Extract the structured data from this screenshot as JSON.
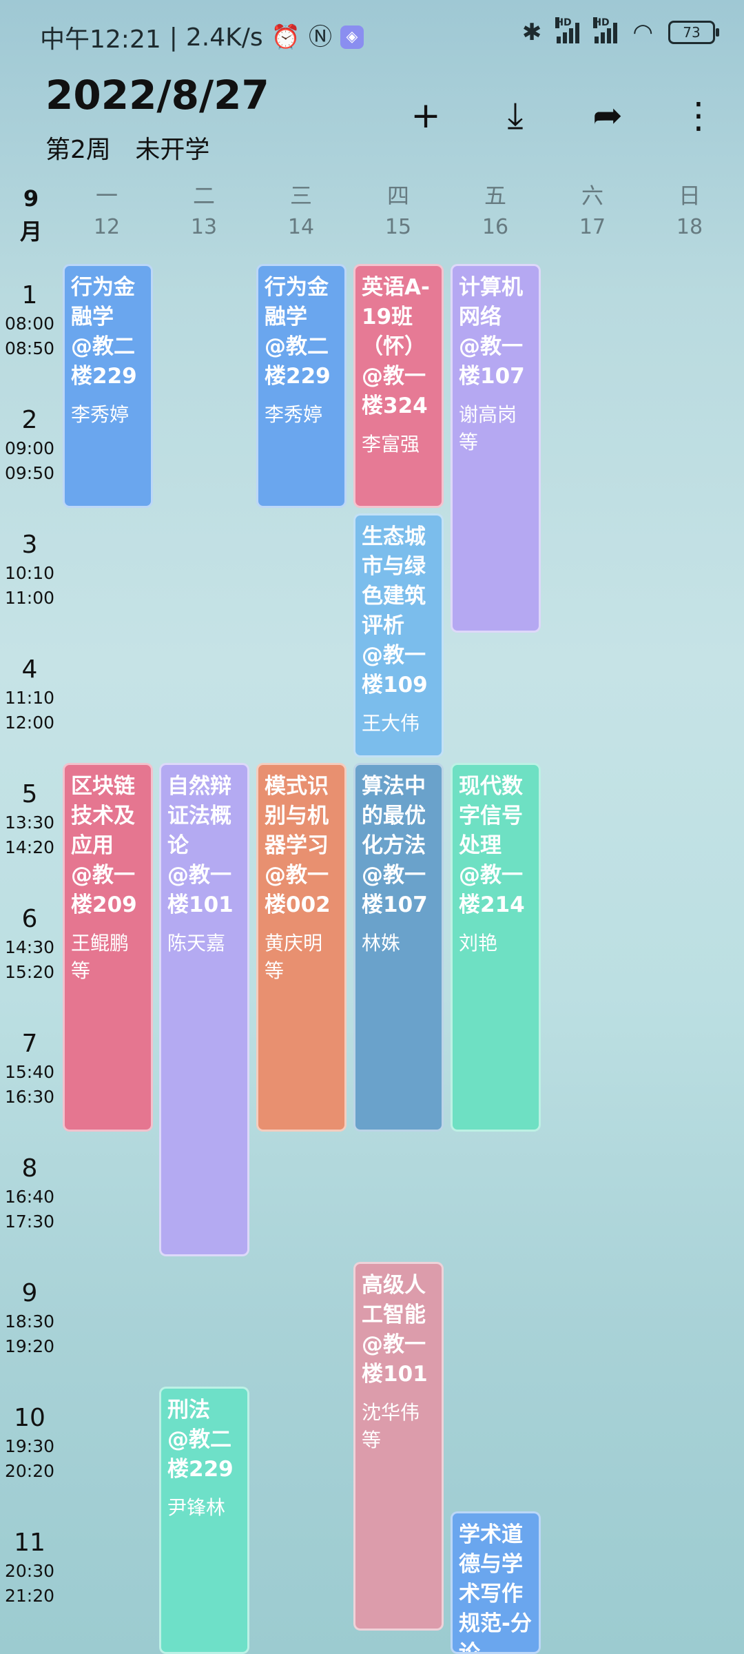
{
  "status_bar": {
    "time": "中午12:21",
    "speed": "2.4K/s",
    "battery": "73"
  },
  "header": {
    "date": "2022/8/27",
    "week": "第2周",
    "status": "未开学"
  },
  "toolbar": {
    "add": "+",
    "download": "⤓",
    "share": "➦",
    "more": "⋮"
  },
  "month": {
    "num": "9",
    "unit": "月"
  },
  "days": [
    {
      "wd": "一",
      "dn": "12"
    },
    {
      "wd": "二",
      "dn": "13"
    },
    {
      "wd": "三",
      "dn": "14"
    },
    {
      "wd": "四",
      "dn": "15"
    },
    {
      "wd": "五",
      "dn": "16"
    },
    {
      "wd": "六",
      "dn": "17"
    },
    {
      "wd": "日",
      "dn": "18"
    }
  ],
  "periods": [
    {
      "n": "1",
      "start": "08:00",
      "end": "08:50"
    },
    {
      "n": "2",
      "start": "09:00",
      "end": "09:50"
    },
    {
      "n": "3",
      "start": "10:10",
      "end": "11:00"
    },
    {
      "n": "4",
      "start": "11:10",
      "end": "12:00"
    },
    {
      "n": "5",
      "start": "13:30",
      "end": "14:20"
    },
    {
      "n": "6",
      "start": "14:30",
      "end": "15:20"
    },
    {
      "n": "7",
      "start": "15:40",
      "end": "16:30"
    },
    {
      "n": "8",
      "start": "16:40",
      "end": "17:30"
    },
    {
      "n": "9",
      "start": "18:30",
      "end": "19:20"
    },
    {
      "n": "10",
      "start": "19:30",
      "end": "20:20"
    },
    {
      "n": "11",
      "start": "20:30",
      "end": "21:20"
    }
  ],
  "courses": [
    {
      "name": "行为金融学",
      "loc": "@教二楼229",
      "teacher": "李秀婷",
      "color": "#6aa6ee"
    },
    {
      "name": "行为金融学",
      "loc": "@教二楼229",
      "teacher": "李秀婷",
      "color": "#6aa6ee"
    },
    {
      "name": "英语A-19班（怀）",
      "loc": "@教一楼324",
      "teacher": "李富强",
      "color": "#e67a95"
    },
    {
      "name": "计算机网络",
      "loc": "@教一楼107",
      "teacher": "谢高岗等",
      "color": "#b5a8f2"
    },
    {
      "name": "生态城市与绿色建筑评析",
      "loc": "@教一楼109",
      "teacher": "王大伟",
      "color": "#7bbdec"
    },
    {
      "name": "区块链技术及应用",
      "loc": "@教一楼209",
      "teacher": "王鲲鹏等",
      "color": "#e57690"
    },
    {
      "name": "自然辩证法概论",
      "loc": "@教一楼101",
      "teacher": "陈天嘉",
      "color": "#b4aaf2"
    },
    {
      "name": "模式识别与机器学习",
      "loc": "@教一楼002",
      "teacher": "黄庆明等",
      "color": "#e89070"
    },
    {
      "name": "算法中的最优化方法",
      "loc": "@教一楼107",
      "teacher": "林姝",
      "color": "#6aa2cb"
    },
    {
      "name": "现代数字信号处理",
      "loc": "@教一楼214",
      "teacher": "刘艳",
      "color": "#6ee0c3"
    },
    {
      "name": "高级人工智能",
      "loc": "@教一楼101",
      "teacher": "沈华伟等",
      "color": "#dc9cab"
    },
    {
      "name": "刑法",
      "loc": "@教二楼229",
      "teacher": "尹锋林",
      "color": "#6ee0c8"
    },
    {
      "name": "学术道德与学术写作规范-分论",
      "loc": "",
      "teacher": "",
      "color": "#6aa6ee"
    }
  ]
}
